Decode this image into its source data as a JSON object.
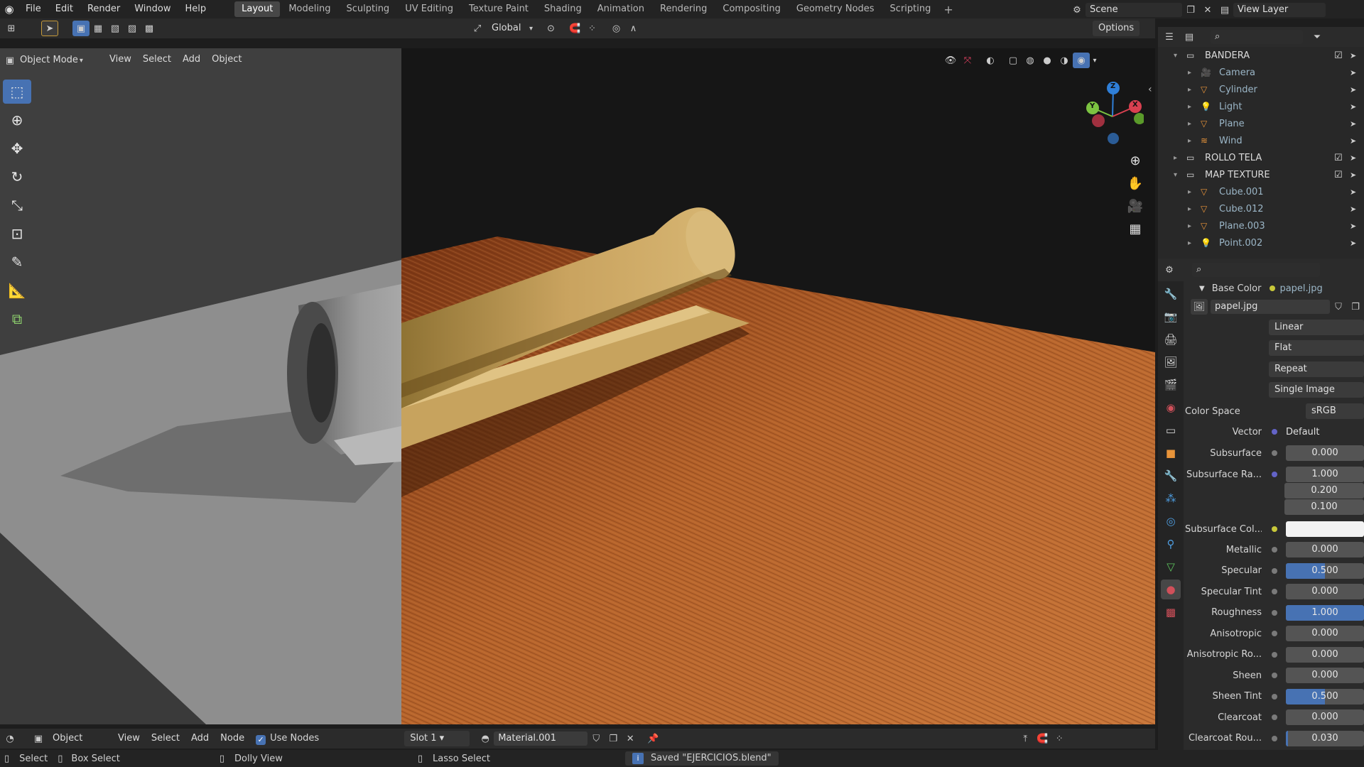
{
  "topbar": {
    "menus": [
      "File",
      "Edit",
      "Render",
      "Window",
      "Help"
    ],
    "workspaces": [
      "Layout",
      "Modeling",
      "Sculpting",
      "UV Editing",
      "Texture Paint",
      "Shading",
      "Animation",
      "Rendering",
      "Compositing",
      "Geometry Nodes",
      "Scripting"
    ],
    "active_workspace": "Layout",
    "scene": "Scene",
    "view_layer": "View Layer"
  },
  "viewport_header": {
    "transform_orientation": "Global",
    "options": "Options",
    "mode": "Object Mode",
    "menus": [
      "View",
      "Select",
      "Add",
      "Object"
    ]
  },
  "gizmo": {
    "x": "X",
    "y": "Y",
    "z": "Z"
  },
  "outliner": {
    "rows": [
      {
        "label": "BANDERA",
        "type": "collection"
      },
      {
        "label": "Camera",
        "type": "object"
      },
      {
        "label": "Cylinder",
        "type": "object"
      },
      {
        "label": "Light",
        "type": "object"
      },
      {
        "label": "Plane",
        "type": "object"
      },
      {
        "label": "Wind",
        "type": "object"
      },
      {
        "label": "ROLLO TELA",
        "type": "collection"
      },
      {
        "label": "MAP TEXTURE",
        "type": "collection"
      },
      {
        "label": "Cube.001",
        "type": "object"
      },
      {
        "label": "Cube.012",
        "type": "object"
      },
      {
        "label": "Plane.003",
        "type": "object"
      },
      {
        "label": "Point.002",
        "type": "object"
      }
    ]
  },
  "properties": {
    "base_color_label": "Base Color",
    "base_color_value": "papel.jpg",
    "image_name": "papel.jpg",
    "interpolation": "Linear",
    "projection": "Flat",
    "extension": "Repeat",
    "source": "Single Image",
    "color_space_label": "Color Space",
    "color_space_value": "sRGB",
    "vector_label": "Vector",
    "vector_value": "Default",
    "subsurface_label": "Subsurface",
    "subsurface_value": "0.000",
    "subsurface_radius_label": "Subsurface Ra...",
    "subsurface_radius": [
      "1.000",
      "0.200",
      "0.100"
    ],
    "subsurface_color_label": "Subsurface Col...",
    "sliders": [
      {
        "label": "Metallic",
        "value": "0.000",
        "fraction": 0
      },
      {
        "label": "Specular",
        "value": "0.500",
        "fraction": 0.5
      },
      {
        "label": "Specular Tint",
        "value": "0.000",
        "fraction": 0
      },
      {
        "label": "Roughness",
        "value": "1.000",
        "fraction": 1
      },
      {
        "label": "Anisotropic",
        "value": "0.000",
        "fraction": 0
      },
      {
        "label": "Anisotropic Ro...",
        "value": "0.000",
        "fraction": 0
      },
      {
        "label": "Sheen",
        "value": "0.000",
        "fraction": 0
      },
      {
        "label": "Sheen Tint",
        "value": "0.500",
        "fraction": 0.5
      },
      {
        "label": "Clearcoat",
        "value": "0.000",
        "fraction": 0
      },
      {
        "label": "Clearcoat Rou...",
        "value": "0.030",
        "fraction": 0.03
      }
    ]
  },
  "bottom_header": {
    "mode": "Object",
    "menus": [
      "View",
      "Select",
      "Add",
      "Node"
    ],
    "use_nodes": "Use Nodes",
    "slot": "Slot 1",
    "material": "Material.001"
  },
  "statusbar": {
    "select": "Select",
    "box_select": "Box Select",
    "dolly_view": "Dolly View",
    "lasso_select": "Lasso Select",
    "message": "Saved \"EJERCICIOS.blend\""
  },
  "colors": {
    "accent": "#4772b3",
    "wood": "#b5622a",
    "paper": "#c9a35f"
  }
}
